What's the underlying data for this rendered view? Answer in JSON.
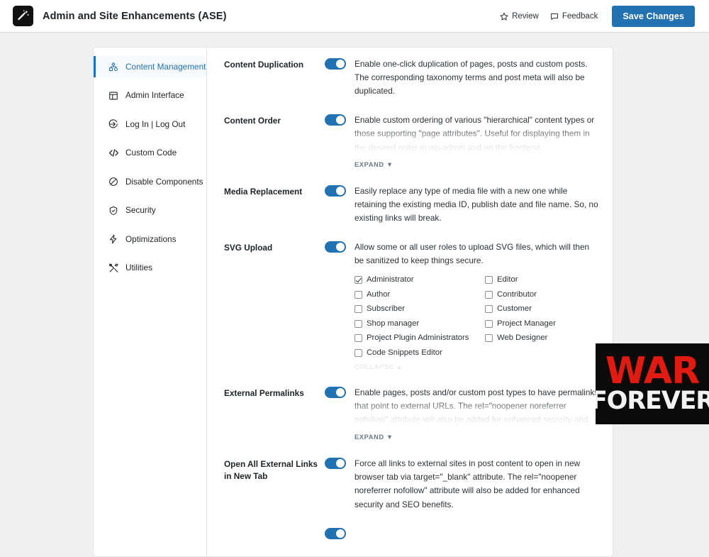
{
  "header": {
    "logo_icon": "magic-wand-icon",
    "title": "Admin and Site Enhancements (ASE)",
    "review_label": "Review",
    "review_icon": "star-icon",
    "feedback_label": "Feedback",
    "feedback_icon": "speech-bubble-icon",
    "save_label": "Save Changes",
    "accent_color": "#2271b1"
  },
  "sidebar": {
    "items": [
      {
        "label": "Content Management",
        "icon": "sitemap-icon",
        "active": true
      },
      {
        "label": "Admin Interface",
        "icon": "layout-grid-icon",
        "active": false
      },
      {
        "label": "Log In | Log Out",
        "icon": "login-arrow-icon",
        "active": false
      },
      {
        "label": "Custom Code",
        "icon": "code-brackets-icon",
        "active": false
      },
      {
        "label": "Disable Components",
        "icon": "no-entry-icon",
        "active": false
      },
      {
        "label": "Security",
        "icon": "shield-check-icon",
        "active": false
      },
      {
        "label": "Optimizations",
        "icon": "lightning-bolt-icon",
        "active": false
      },
      {
        "label": "Utilities",
        "icon": "crossed-tools-icon",
        "active": false
      }
    ]
  },
  "settings": {
    "expand_label": "EXPAND ▼",
    "collapse_label": "COLLAPSE ▲",
    "rows": [
      {
        "label": "Content Duplication",
        "enabled": true,
        "description": "Enable one-click duplication of pages, posts and custom posts. The corresponding taxonomy terms and post meta will also be duplicated."
      },
      {
        "label": "Content Order",
        "enabled": true,
        "description": "Enable custom ordering of various \"hierarchical\" content types or those supporting \"page attributes\". Useful for displaying them in the desired order in wp-admin and on the frontend."
      },
      {
        "label": "Media Replacement",
        "enabled": true,
        "description": "Easily replace any type of media file with a new one while retaining the existing media ID, publish date and file name. So, no existing links will break."
      },
      {
        "label": "SVG Upload",
        "enabled": true,
        "description": "Allow some or all user roles to upload SVG files, which will then be sanitized to keep things secure."
      },
      {
        "label": "External Permalinks",
        "enabled": true,
        "description": "Enable pages, posts and/or custom post types to have permalinks that point to external URLs. The rel=\"noopener noreferrer nofollow\" attribute will also be added for enhanced security and SEO benefits. Compatible with links added using Page Links To."
      },
      {
        "label": "Open All External Links in New Tab",
        "enabled": true,
        "description": "Force all links to external sites in post content to open in new browser tab via target=\"_blank\" attribute. The rel=\"noopener noreferrer nofollow\" attribute will also be added for enhanced security and SEO benefits."
      }
    ],
    "svg_roles": [
      {
        "label": "Administrator",
        "checked": true
      },
      {
        "label": "Editor",
        "checked": false
      },
      {
        "label": "Author",
        "checked": false
      },
      {
        "label": "Contributor",
        "checked": false
      },
      {
        "label": "Subscriber",
        "checked": false
      },
      {
        "label": "Customer",
        "checked": false
      },
      {
        "label": "Shop manager",
        "checked": false
      },
      {
        "label": "Project Manager",
        "checked": false
      },
      {
        "label": "Project Plugin Administrators",
        "checked": false
      },
      {
        "label": "Web Designer",
        "checked": false
      },
      {
        "label": "Code Snippets Editor",
        "checked": false
      }
    ]
  },
  "overlay": {
    "line1": "WAR",
    "line2": "FOREVER",
    "war_color": "#e01b12",
    "forever_color": "#f2f2f2",
    "background": "#0b0b0b"
  }
}
